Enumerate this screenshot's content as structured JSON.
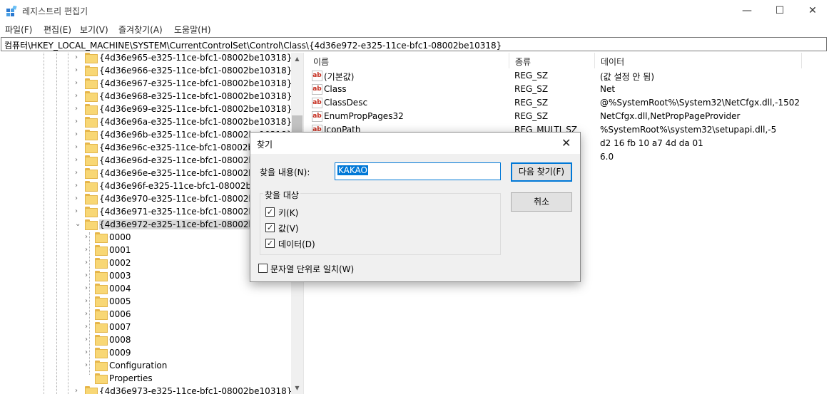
{
  "window": {
    "title": "레지스트리 편집기",
    "minimize": "—",
    "maximize": "☐",
    "close": "✕"
  },
  "menu": [
    "파일(F)",
    "편집(E)",
    "보기(V)",
    "즐겨찾기(A)",
    "도움말(H)"
  ],
  "address": "컴퓨터\\HKEY_LOCAL_MACHINE\\SYSTEM\\CurrentControlSet\\Control\\Class\\{4d36e972-e325-11ce-bfc1-08002be10318}",
  "tree": [
    {
      "label": "{4d36e965-e325-11ce-bfc1-08002be10318}",
      "chev": "›",
      "level": 0
    },
    {
      "label": "{4d36e966-e325-11ce-bfc1-08002be10318}",
      "chev": "›",
      "level": 0
    },
    {
      "label": "{4d36e967-e325-11ce-bfc1-08002be10318}",
      "chev": "›",
      "level": 0
    },
    {
      "label": "{4d36e968-e325-11ce-bfc1-08002be10318}",
      "chev": "›",
      "level": 0
    },
    {
      "label": "{4d36e969-e325-11ce-bfc1-08002be10318}",
      "chev": "›",
      "level": 0
    },
    {
      "label": "{4d36e96a-e325-11ce-bfc1-08002be10318}",
      "chev": "›",
      "level": 0
    },
    {
      "label": "{4d36e96b-e325-11ce-bfc1-08002be10318}",
      "chev": "›",
      "level": 0
    },
    {
      "label": "{4d36e96c-e325-11ce-bfc1-08002be10318}",
      "chev": "›",
      "level": 0
    },
    {
      "label": "{4d36e96d-e325-11ce-bfc1-08002be10318}",
      "chev": "›",
      "level": 0
    },
    {
      "label": "{4d36e96e-e325-11ce-bfc1-08002be10318}",
      "chev": "›",
      "level": 0
    },
    {
      "label": "{4d36e96f-e325-11ce-bfc1-08002be10318}",
      "chev": "›",
      "level": 0
    },
    {
      "label": "{4d36e970-e325-11ce-bfc1-08002be10318}",
      "chev": "›",
      "level": 0
    },
    {
      "label": "{4d36e971-e325-11ce-bfc1-08002be10318}",
      "chev": "›",
      "level": 0
    },
    {
      "label": "{4d36e972-e325-11ce-bfc1-08002be10318}",
      "chev": "⌄",
      "level": 0,
      "selected": true
    },
    {
      "label": "0000",
      "chev": "›",
      "level": 1
    },
    {
      "label": "0001",
      "chev": "›",
      "level": 1
    },
    {
      "label": "0002",
      "chev": "›",
      "level": 1
    },
    {
      "label": "0003",
      "chev": "›",
      "level": 1
    },
    {
      "label": "0004",
      "chev": "›",
      "level": 1
    },
    {
      "label": "0005",
      "chev": "›",
      "level": 1
    },
    {
      "label": "0006",
      "chev": "›",
      "level": 1
    },
    {
      "label": "0007",
      "chev": "›",
      "level": 1
    },
    {
      "label": "0008",
      "chev": "›",
      "level": 1
    },
    {
      "label": "0009",
      "chev": "›",
      "level": 1
    },
    {
      "label": "Configuration",
      "chev": "›",
      "level": 1
    },
    {
      "label": "Properties",
      "chev": "",
      "level": 1
    },
    {
      "label": "{4d36e973-e325-11ce-bfc1-08002be10318}",
      "chev": "›",
      "level": 0
    }
  ],
  "columns": {
    "name": "이름",
    "type": "종류",
    "data": "데이터"
  },
  "values": [
    {
      "name": "(기본값)",
      "type": "REG_SZ",
      "data": "(값 설정 안 됨)"
    },
    {
      "name": "Class",
      "type": "REG_SZ",
      "data": "Net"
    },
    {
      "name": "ClassDesc",
      "type": "REG_SZ",
      "data": "@%SystemRoot%\\System32\\NetCfgx.dll,-1502"
    },
    {
      "name": "EnumPropPages32",
      "type": "REG_SZ",
      "data": "NetCfgx.dll,NetPropPageProvider"
    },
    {
      "name": "IconPath",
      "type": "REG_MULTI_SZ",
      "data": "%SystemRoot%\\system32\\setupapi.dll,-5"
    },
    {
      "name": "",
      "type": "",
      "data": "d2 16 fb 10 a7 4d da 01"
    },
    {
      "name": "",
      "type": "",
      "data": "6.0"
    }
  ],
  "value_icon": "ab",
  "dialog": {
    "title": "찾기",
    "close": "✕",
    "find_label": "찾을 내용(N):",
    "find_value": "KAKAO",
    "find_next": "다음 찾기(F)",
    "cancel": "취소",
    "group_label": "찾을 대상",
    "keys_label": "키(K)",
    "values_label": "값(V)",
    "data_label": "데이터(D)",
    "keys_checked": true,
    "values_checked": true,
    "data_checked": true,
    "whole_label": "문자열 단위로 일치(W)",
    "whole_checked": false,
    "check_mark": "✓"
  }
}
